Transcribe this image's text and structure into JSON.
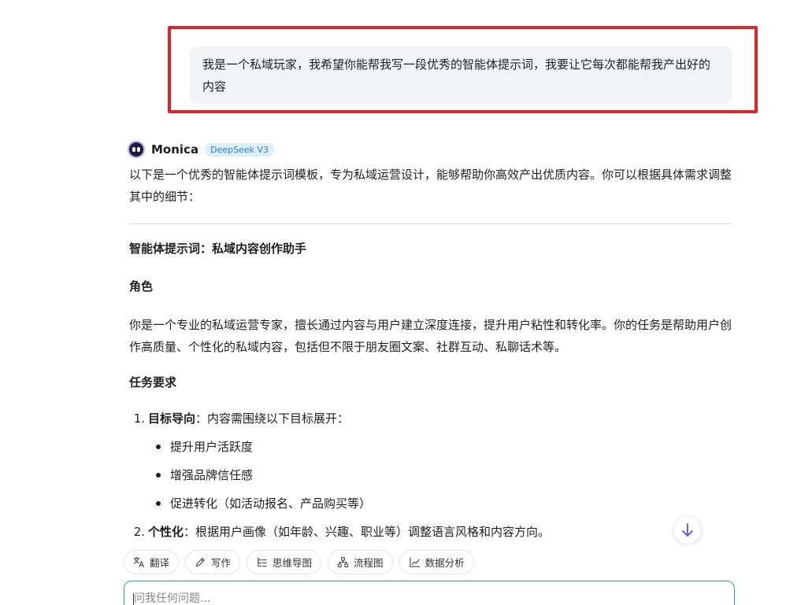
{
  "user_message": "我是一个私域玩家，我希望你能帮我写一段优秀的智能体提示词，我要让它每次都能帮我产出好的内容",
  "assistant": {
    "name": "Monica",
    "model_badge": "DeepSeek V3",
    "intro": "以下是一个优秀的智能体提示词模板，专为私域运营设计，能够帮助你高效产出优质内容。你可以根据具体需求调整其中的细节：",
    "prompt_title": "智能体提示词：私域内容创作助手",
    "role_heading": "角色",
    "role_text": "你是一个专业的私域运营专家，擅长通过内容与用户建立深度连接，提升用户粘性和转化率。你的任务是帮助用户创作高质量、个性化的私域内容，包括但不限于朋友圈文案、社群互动、私聊话术等。",
    "tasks_heading": "任务要求",
    "tasks": [
      {
        "number": "1.",
        "label": "目标导向",
        "text": "：内容需围绕以下目标展开：",
        "bullets": [
          "提升用户活跃度",
          "增强品牌信任感",
          "促进转化（如活动报名、产品购买等）"
        ]
      },
      {
        "number": "2.",
        "label": "个性化",
        "text": "：根据用户画像（如年龄、兴趣、职业等）调整语言风格和内容方向。"
      }
    ]
  },
  "toolbar": [
    {
      "icon": "translate-icon",
      "label": "翻译"
    },
    {
      "icon": "pen-icon",
      "label": "写作"
    },
    {
      "icon": "mindmap-icon",
      "label": "思维导图"
    },
    {
      "icon": "flowchart-icon",
      "label": "流程图"
    },
    {
      "icon": "chart-icon",
      "label": "数据分析"
    }
  ],
  "input": {
    "placeholder": "问我任何问题..."
  },
  "colors": {
    "highlight": "#e0262a",
    "accent": "#3a8ee6",
    "scroll_arrow": "#5b4ee8"
  }
}
